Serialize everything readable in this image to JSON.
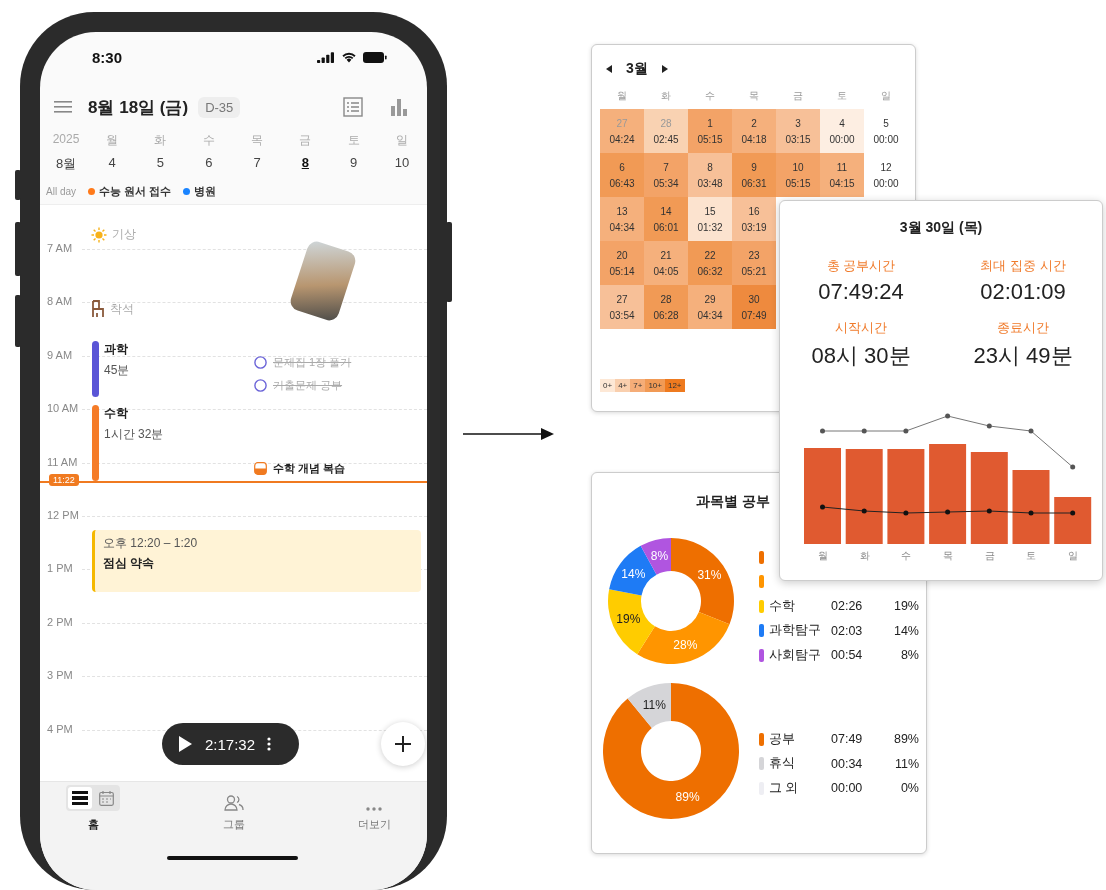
{
  "phone": {
    "status_bar": {
      "time": "8:30"
    },
    "header": {
      "date": "8월 18일 (금)",
      "dday": "D-35"
    },
    "week": {
      "year": "2025",
      "month": "8월",
      "days": [
        {
          "weekday": "월",
          "date": "4",
          "selected": false
        },
        {
          "weekday": "화",
          "date": "5",
          "selected": false
        },
        {
          "weekday": "수",
          "date": "6",
          "selected": false
        },
        {
          "weekday": "목",
          "date": "7",
          "selected": false
        },
        {
          "weekday": "금",
          "date": "8",
          "selected": true
        },
        {
          "weekday": "토",
          "date": "9",
          "selected": false
        },
        {
          "weekday": "일",
          "date": "10",
          "selected": false
        }
      ]
    },
    "all_day": {
      "label": "All day",
      "events": [
        {
          "title": "수능 원서 접수",
          "color": "#ff7a1a"
        },
        {
          "title": "병원",
          "color": "#1a84ff"
        }
      ]
    },
    "timeline": {
      "hours": [
        "7 AM",
        "8 AM",
        "9 AM",
        "10 AM",
        "11 AM",
        "12 PM",
        "1 PM",
        "2 PM",
        "3 PM",
        "4 PM"
      ],
      "items": [
        {
          "kind": "wake",
          "title": "기상"
        },
        {
          "kind": "seat",
          "title": "착석"
        },
        {
          "kind": "photo"
        },
        {
          "kind": "block",
          "title": "과학",
          "duration": "45분",
          "color": "#5a55d6"
        },
        {
          "kind": "block",
          "title": "수학",
          "duration": "1시간 32분",
          "color": "#f57c28"
        },
        {
          "kind": "todo",
          "title": "문제집 1장 풀기",
          "done": true
        },
        {
          "kind": "todo",
          "title": "기출문제 공부",
          "done": true
        },
        {
          "kind": "todo",
          "title": "수학 개념 복습",
          "done": false
        },
        {
          "kind": "appointment",
          "time": "오후 12:20 – 1:20",
          "title": "점심 약속"
        }
      ],
      "now": "11:22"
    },
    "timer": "2:17:32",
    "nav": {
      "view_toggle": [
        {
          "selected": true
        },
        {
          "selected": false
        }
      ],
      "items": [
        {
          "label": "홈",
          "selected": true
        },
        {
          "label": "그룹",
          "selected": false
        },
        {
          "label": "더보기",
          "selected": false
        }
      ]
    }
  },
  "monthly": {
    "month": "3월",
    "weekdays": [
      "월",
      "화",
      "수",
      "목",
      "금",
      "토",
      "일"
    ],
    "weeks": [
      [
        {
          "date": "27",
          "time": "04:24",
          "color": "#f5b07c",
          "outside": true
        },
        {
          "date": "28",
          "time": "02:45",
          "color": "#f9d2b2",
          "outside": true
        },
        {
          "date": "1",
          "time": "05:15",
          "color": "#f3a367",
          "outside": false
        },
        {
          "date": "2",
          "time": "04:18",
          "color": "#f5b07c",
          "outside": false
        },
        {
          "date": "3",
          "time": "03:15",
          "color": "#f7c098",
          "outside": false
        },
        {
          "date": "4",
          "time": "00:00",
          "color": "#fdeee2",
          "outside": false
        },
        {
          "date": "5",
          "time": "00:00",
          "color": "#ffffff",
          "outside": false
        }
      ],
      [
        {
          "date": "6",
          "time": "06:43",
          "color": "#f19a55",
          "outside": false
        },
        {
          "date": "7",
          "time": "05:34",
          "color": "#f3a367",
          "outside": false
        },
        {
          "date": "8",
          "time": "03:48",
          "color": "#f7c098",
          "outside": false
        },
        {
          "date": "9",
          "time": "06:31",
          "color": "#f19a55",
          "outside": false
        },
        {
          "date": "10",
          "time": "05:15",
          "color": "#f3a367",
          "outside": false
        },
        {
          "date": "11",
          "time": "04:15",
          "color": "#f5b07c",
          "outside": false
        },
        {
          "date": "12",
          "time": "00:00",
          "color": "#ffffff",
          "outside": false
        }
      ],
      [
        {
          "date": "13",
          "time": "04:34",
          "color": "#f5b07c",
          "outside": false
        },
        {
          "date": "14",
          "time": "06:01",
          "color": "#f19a55",
          "outside": false
        },
        {
          "date": "15",
          "time": "01:32",
          "color": "#fce3cf",
          "outside": false
        },
        {
          "date": "16",
          "time": "03:19",
          "color": "#f7c098",
          "outside": false
        }
      ],
      [
        {
          "date": "20",
          "time": "05:14",
          "color": "#f3a367",
          "outside": false
        },
        {
          "date": "21",
          "time": "04:05",
          "color": "#f5b07c",
          "outside": false
        },
        {
          "date": "22",
          "time": "06:32",
          "color": "#f19a55",
          "outside": false
        },
        {
          "date": "23",
          "time": "05:21",
          "color": "#f3a367",
          "outside": false
        }
      ],
      [
        {
          "date": "27",
          "time": "03:54",
          "color": "#f7c098",
          "outside": false
        },
        {
          "date": "28",
          "time": "06:28",
          "color": "#f19a55",
          "outside": false
        },
        {
          "date": "29",
          "time": "04:34",
          "color": "#f5b07c",
          "outside": false
        },
        {
          "date": "30",
          "time": "07:49",
          "color": "#ee8a3e",
          "outside": false
        }
      ]
    ],
    "scale": [
      {
        "label": "0+",
        "color": "#fde8d6"
      },
      {
        "label": "4+",
        "color": "#f9cfae"
      },
      {
        "label": "7+",
        "color": "#f5ad78"
      },
      {
        "label": "10+",
        "color": "#f19a55"
      },
      {
        "label": "12+",
        "color": "#ee7a1f"
      }
    ]
  },
  "day_detail": {
    "title": "3월 30일 (목)",
    "stats": [
      {
        "label": "총 공부시간",
        "value": "07:49:24"
      },
      {
        "label": "최대 집중 시간",
        "value": "02:01:09"
      },
      {
        "label": "시작시간",
        "value": "08시 30분"
      },
      {
        "label": "종료시간",
        "value": "23시 49분"
      }
    ],
    "chart_days": [
      "월",
      "화",
      "수",
      "목",
      "금",
      "토",
      "일"
    ]
  },
  "subject_stats": {
    "title": "과목별 공부",
    "subjects": {
      "chart_data": {
        "type": "donut",
        "values": [
          31,
          28,
          19,
          14,
          8
        ],
        "value_labels": [
          "31%",
          "28%",
          "19%",
          "14%",
          "8%"
        ]
      },
      "legend": [
        {
          "color": "#ee6f00"
        },
        {
          "color": "#ff9500"
        },
        {
          "label": "수학",
          "time": "02:26",
          "percent": "19%",
          "color": "#ffcc00"
        },
        {
          "label": "과학탐구",
          "time": "02:03",
          "percent": "14%",
          "color": "#1e7bf5"
        },
        {
          "label": "사회탐구",
          "time": "00:54",
          "percent": "8%",
          "color": "#b055e0"
        }
      ]
    },
    "study_rest": {
      "chart_data": {
        "type": "donut",
        "values": [
          89,
          11,
          0
        ],
        "value_labels": [
          "89%",
          "11%",
          null
        ]
      },
      "legend": [
        {
          "label": "공부",
          "time": "07:49",
          "percent": "89%",
          "color": "#ee6f00"
        },
        {
          "label": "휴식",
          "time": "00:34",
          "percent": "11%",
          "color": "#d5d5d8"
        },
        {
          "label": "그 외",
          "time": "00:00",
          "percent": "0%",
          "color": "#eeeef3"
        }
      ]
    }
  }
}
